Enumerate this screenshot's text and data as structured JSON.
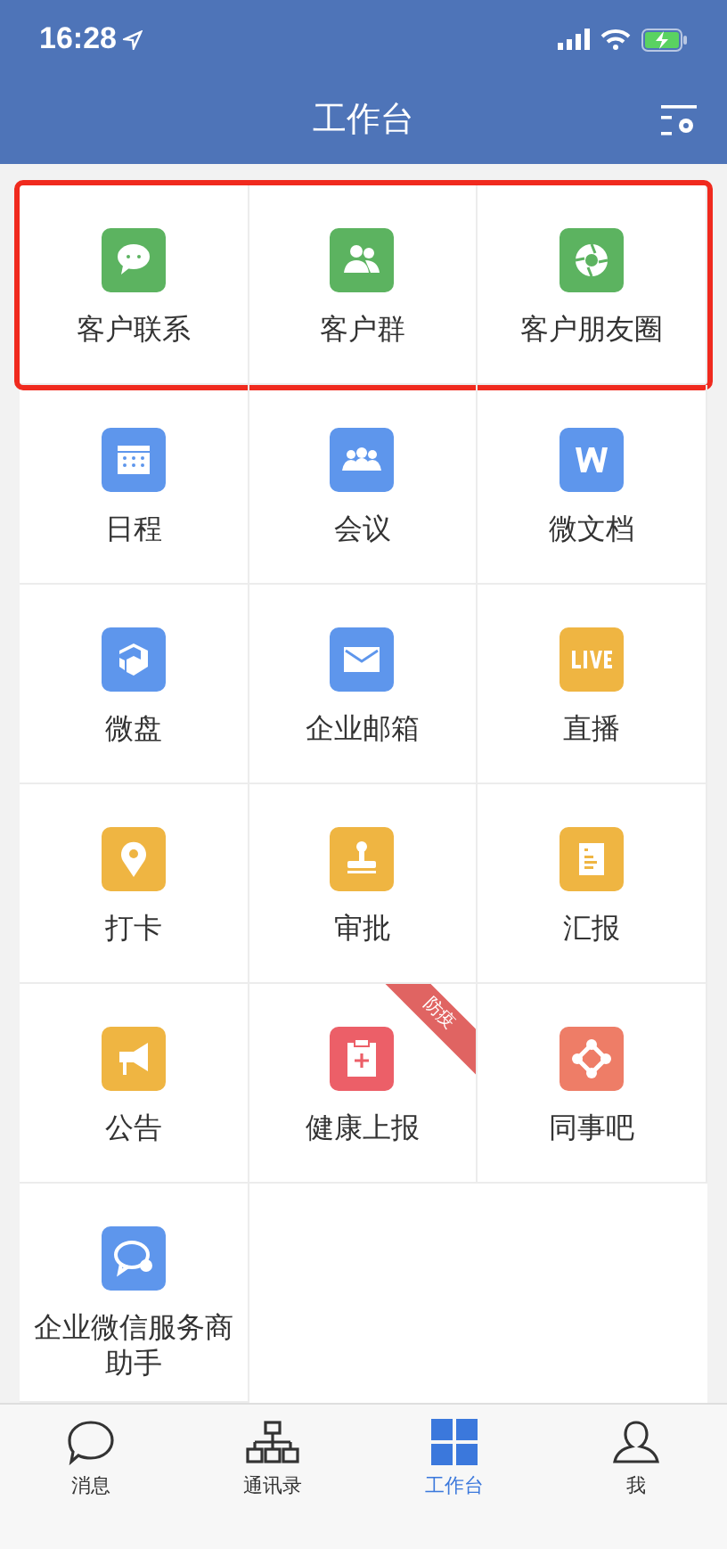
{
  "status_bar": {
    "time": "16:28"
  },
  "header": {
    "title": "工作台"
  },
  "grid": {
    "highlight_first_row": true,
    "items": [
      {
        "label": "客户联系",
        "kind": "chat",
        "color": "#5cb360"
      },
      {
        "label": "客户群",
        "kind": "people",
        "color": "#5cb360"
      },
      {
        "label": "客户朋友圈",
        "kind": "shutter",
        "color": "#5cb360"
      },
      {
        "label": "日程",
        "kind": "calendar",
        "color": "#5e96ec"
      },
      {
        "label": "会议",
        "kind": "group",
        "color": "#5e96ec"
      },
      {
        "label": "微文档",
        "kind": "doc",
        "color": "#5e96ec"
      },
      {
        "label": "微盘",
        "kind": "disk",
        "color": "#5e96ec"
      },
      {
        "label": "企业邮箱",
        "kind": "mail",
        "color": "#5e96ec"
      },
      {
        "label": "直播",
        "kind": "live",
        "color": "#efb542"
      },
      {
        "label": "打卡",
        "kind": "pin",
        "color": "#efb542"
      },
      {
        "label": "审批",
        "kind": "stamp",
        "color": "#efb542"
      },
      {
        "label": "汇报",
        "kind": "report",
        "color": "#efb542"
      },
      {
        "label": "公告",
        "kind": "megaphone",
        "color": "#efb542"
      },
      {
        "label": "健康上报",
        "kind": "clipboard",
        "color": "#ec5f68",
        "ribbon": "防疫"
      },
      {
        "label": "同事吧",
        "kind": "nodes",
        "color": "#ee7d67"
      },
      {
        "label": "企业微信服务商助手",
        "kind": "bubble",
        "color": "#5e96ec"
      }
    ]
  },
  "tab_bar": {
    "tabs": [
      {
        "label": "消息",
        "kind": "chat",
        "selected": false
      },
      {
        "label": "通讯录",
        "kind": "tree",
        "selected": false
      },
      {
        "label": "工作台",
        "kind": "grid",
        "selected": true
      },
      {
        "label": "我",
        "kind": "person",
        "selected": false
      }
    ]
  }
}
